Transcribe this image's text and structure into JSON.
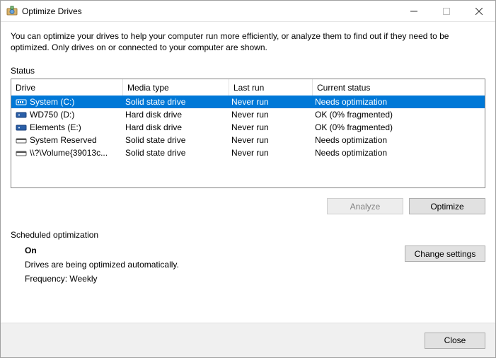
{
  "window": {
    "title": "Optimize Drives"
  },
  "intro": "You can optimize your drives to help your computer run more efficiently, or analyze them to find out if they need to be optimized. Only drives on or connected to your computer are shown.",
  "status_label": "Status",
  "columns": {
    "drive": "Drive",
    "media": "Media type",
    "last": "Last run",
    "status": "Current status"
  },
  "drives": [
    {
      "icon": "ssd",
      "name": "System (C:)",
      "media": "Solid state drive",
      "last": "Never run",
      "status": "Needs optimization",
      "selected": true
    },
    {
      "icon": "hdd",
      "name": "WD750 (D:)",
      "media": "Hard disk drive",
      "last": "Never run",
      "status": "OK (0% fragmented)",
      "selected": false
    },
    {
      "icon": "hdd",
      "name": "Elements (E:)",
      "media": "Hard disk drive",
      "last": "Never run",
      "status": "OK (0% fragmented)",
      "selected": false
    },
    {
      "icon": "vol",
      "name": "System Reserved",
      "media": "Solid state drive",
      "last": "Never run",
      "status": "Needs optimization",
      "selected": false
    },
    {
      "icon": "vol",
      "name": "\\\\?\\Volume{39013c...",
      "media": "Solid state drive",
      "last": "Never run",
      "status": "Needs optimization",
      "selected": false
    }
  ],
  "buttons": {
    "analyze": "Analyze",
    "optimize": "Optimize",
    "change": "Change settings",
    "close": "Close"
  },
  "schedule": {
    "heading": "Scheduled optimization",
    "state": "On",
    "desc": "Drives are being optimized automatically.",
    "freq": "Frequency: Weekly"
  }
}
